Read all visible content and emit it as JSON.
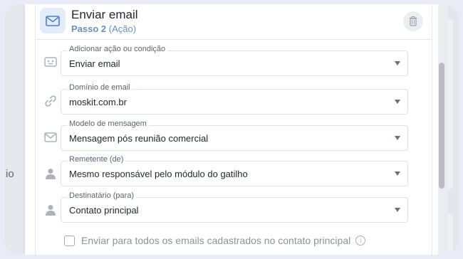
{
  "background": {
    "partial_text": "io"
  },
  "step": {
    "title": "Enviar email",
    "subtitle_bold": "Passo 2",
    "subtitle_rest": "(Ação)"
  },
  "fields": [
    {
      "label": "Adicionar ação ou condição",
      "value": "Enviar email",
      "icon": "robot-icon"
    },
    {
      "label": "Domínio de email",
      "value": "moskit.com.br",
      "icon": "link-icon"
    },
    {
      "label": "Modelo de mensagem",
      "value": "Mensagem pós reunião comercial",
      "icon": "envelope-icon"
    },
    {
      "label": "Remetente (de)",
      "value": "Mesmo responsável pelo módulo do gatilho",
      "icon": "user-icon"
    },
    {
      "label": "Destinatário (para)",
      "value": "Contato principal",
      "icon": "user-icon"
    }
  ],
  "checkbox": {
    "label": "Enviar para todos os emails cadastrados no contato principal",
    "checked": false
  },
  "colors": {
    "accent": "#4a7fd4",
    "subtitle": "#6a8fc4",
    "icon_gray": "#aeb2bb"
  }
}
